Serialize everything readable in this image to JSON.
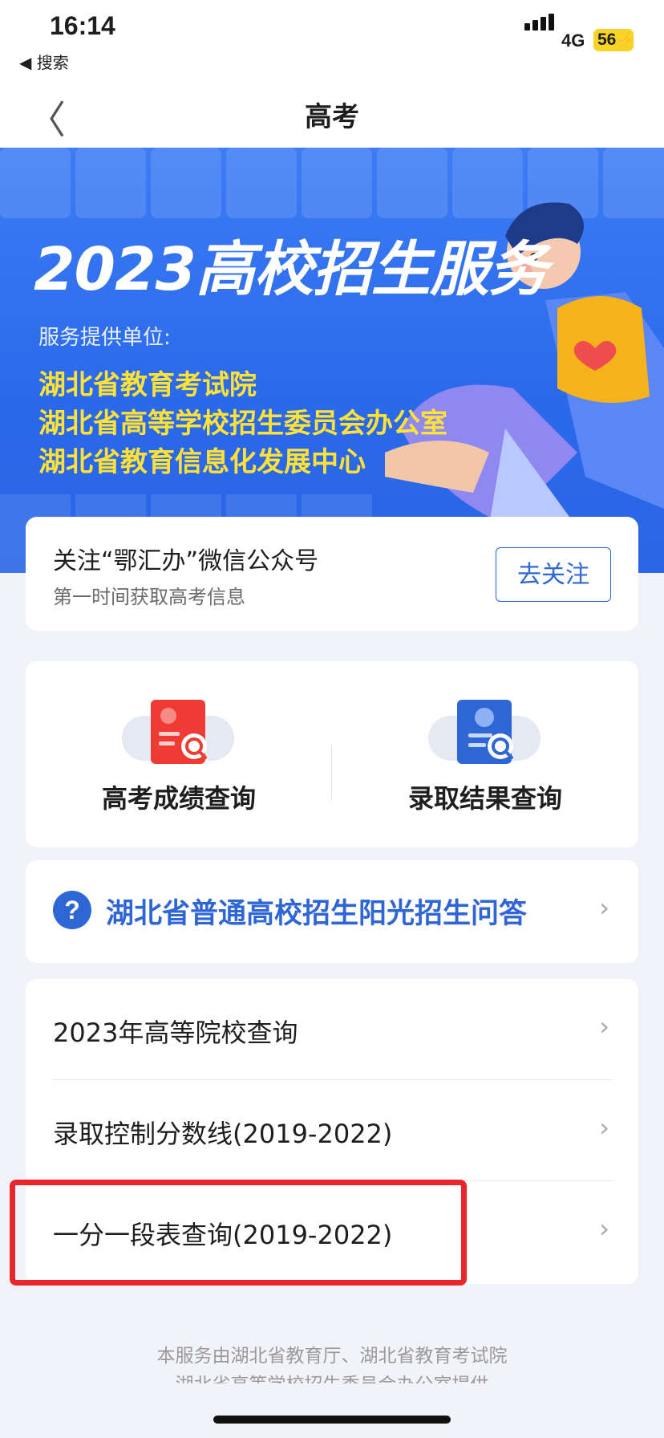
{
  "status": {
    "time": "16:14",
    "back_app": "◀ 搜索",
    "network": "4G",
    "battery": "56"
  },
  "nav": {
    "back_glyph": "〈",
    "title": "高考"
  },
  "banner": {
    "title": "2023高校招生服务",
    "provider_label": "服务提供单位:",
    "providers": [
      "湖北省教育考试院",
      "湖北省高等学校招生委员会办公室",
      "湖北省教育信息化发展中心"
    ]
  },
  "follow": {
    "title": "关注“鄂汇办”微信公众号",
    "subtitle": "第一时间获取高考信息",
    "button": "去关注"
  },
  "quick": [
    {
      "label": "高考成绩查询",
      "color": "#ef3b33",
      "icon": "score-report-icon"
    },
    {
      "label": "录取结果查询",
      "color": "#2f66d6",
      "icon": "admission-certificate-icon"
    }
  ],
  "faq": {
    "icon_glyph": "?",
    "label": "湖北省普通高校招生阳光招生问答",
    "chevron": "›"
  },
  "list": [
    {
      "label": "2023年高等院校查询",
      "chevron": "›"
    },
    {
      "label": "录取控制分数线(2019-2022)",
      "chevron": "›"
    },
    {
      "label": "一分一段表查询(2019-2022)",
      "chevron": "›"
    }
  ],
  "footer": {
    "line1": "本服务由湖北省教育厅、湖北省教育考试院",
    "line2": "湖北省高等学校招生委员会办公室提供"
  },
  "colors": {
    "accent": "#2f66d6",
    "highlight": "#e8262b",
    "banner": "#2a69ea",
    "provider_text": "#ffe238"
  }
}
